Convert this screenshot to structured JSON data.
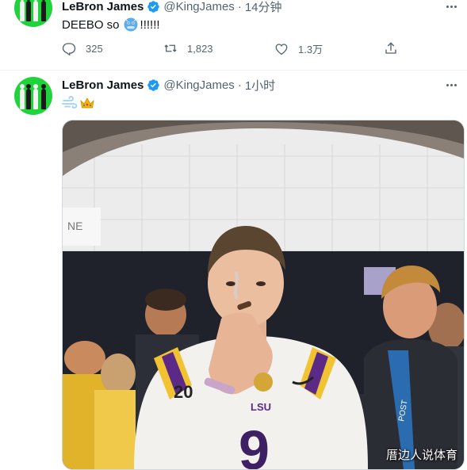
{
  "tweets": [
    {
      "author_name": "LeBron James",
      "handle": "@KingJames",
      "separator": "·",
      "time": "14分钟",
      "text_before": "DEEBO so",
      "emoji_name": "cold-face-emoji",
      "text_after": "!!!!!!",
      "stats": {
        "replies": "325",
        "retweets": "1,823",
        "likes": "1.3万"
      }
    },
    {
      "author_name": "LeBron James",
      "handle": "@KingJames",
      "separator": "·",
      "time": "1小时",
      "emojis": [
        "dash-emoji",
        "crown-emoji"
      ],
      "media": {
        "description_icon": "photo",
        "watermark": "厝边人说体育",
        "banner_text": "NE",
        "jersey_text": "LSU",
        "jersey_number": "9",
        "shoulder_number": "20"
      }
    }
  ],
  "colors": {
    "avatar_bg": "#1fd33a",
    "verified_blue": "#1d9bf0",
    "secondary_text": "#536471",
    "lsu_purple": "#5b2a86",
    "lsu_gold": "#f1c232"
  }
}
